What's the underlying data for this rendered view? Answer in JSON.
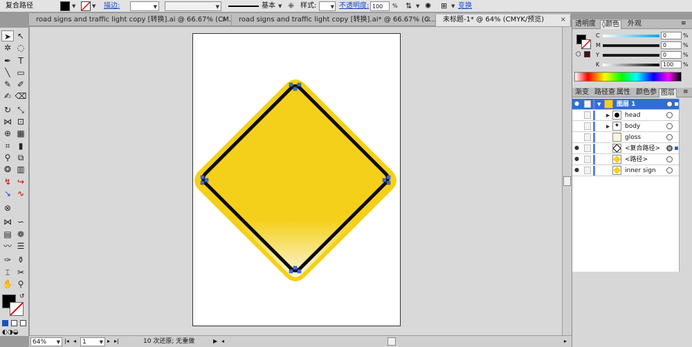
{
  "control_bar": {
    "object_type": "复合路径",
    "stroke_label": "描边:",
    "stroke_profile": "基本",
    "style_label": "样式:",
    "opacity_label": "不透明度:",
    "opacity_value": "100",
    "opacity_unit": "%",
    "transform_link": "变换",
    "fill_color": "#000000"
  },
  "document_tabs": [
    {
      "label": "road signs and traffic light copy [转换].ai @ 66.67% (CM...",
      "close": "×"
    },
    {
      "label": "road signs and traffic light copy [转换].ai* @ 66.67% (C...",
      "close": "×"
    },
    {
      "label": "未标题-1* @ 64% (CMYK/预览)",
      "close": "×"
    }
  ],
  "status_bar": {
    "zoom": "64%",
    "artboard_number": "1",
    "undo_status": "10 次还原; 无重做"
  },
  "color_panel": {
    "tabs": [
      "透明度",
      "颜色",
      "外观"
    ],
    "active_tab": "颜色",
    "channels": [
      {
        "label": "C",
        "value": "0"
      },
      {
        "label": "M",
        "value": "0"
      },
      {
        "label": "Y",
        "value": "0"
      },
      {
        "label": "K",
        "value": "100"
      }
    ],
    "unit": "%"
  },
  "layers_panel": {
    "tabs": [
      "渐变",
      "路径查",
      "属性",
      "颜色参",
      "图层"
    ],
    "active_tab": "图层",
    "rows": [
      {
        "name": "图层 1",
        "level": 0,
        "selected": true,
        "expanded": true,
        "visible": true,
        "thumb": "yellow"
      },
      {
        "name": "head",
        "level": 1,
        "selected": false,
        "expandable": true,
        "visible": false,
        "thumb": "dot"
      },
      {
        "name": "body",
        "level": 1,
        "selected": false,
        "expandable": true,
        "visible": false,
        "thumb": "figure"
      },
      {
        "name": "gloss",
        "level": 1,
        "selected": false,
        "visible": false,
        "thumb": "gloss"
      },
      {
        "name": "<复合路径>",
        "level": 1,
        "selected": false,
        "visible": true,
        "thumb": "outline",
        "targeted": true
      },
      {
        "name": "<路径>",
        "level": 1,
        "selected": false,
        "visible": true,
        "thumb": "yellow"
      },
      {
        "name": "inner sign",
        "level": 1,
        "selected": false,
        "visible": true,
        "thumb": "yellow"
      }
    ]
  },
  "colors": {
    "sign_yellow": "#f5d01a",
    "sign_border": "#0c0c0c",
    "selection_blue": "#2f6fd1"
  }
}
